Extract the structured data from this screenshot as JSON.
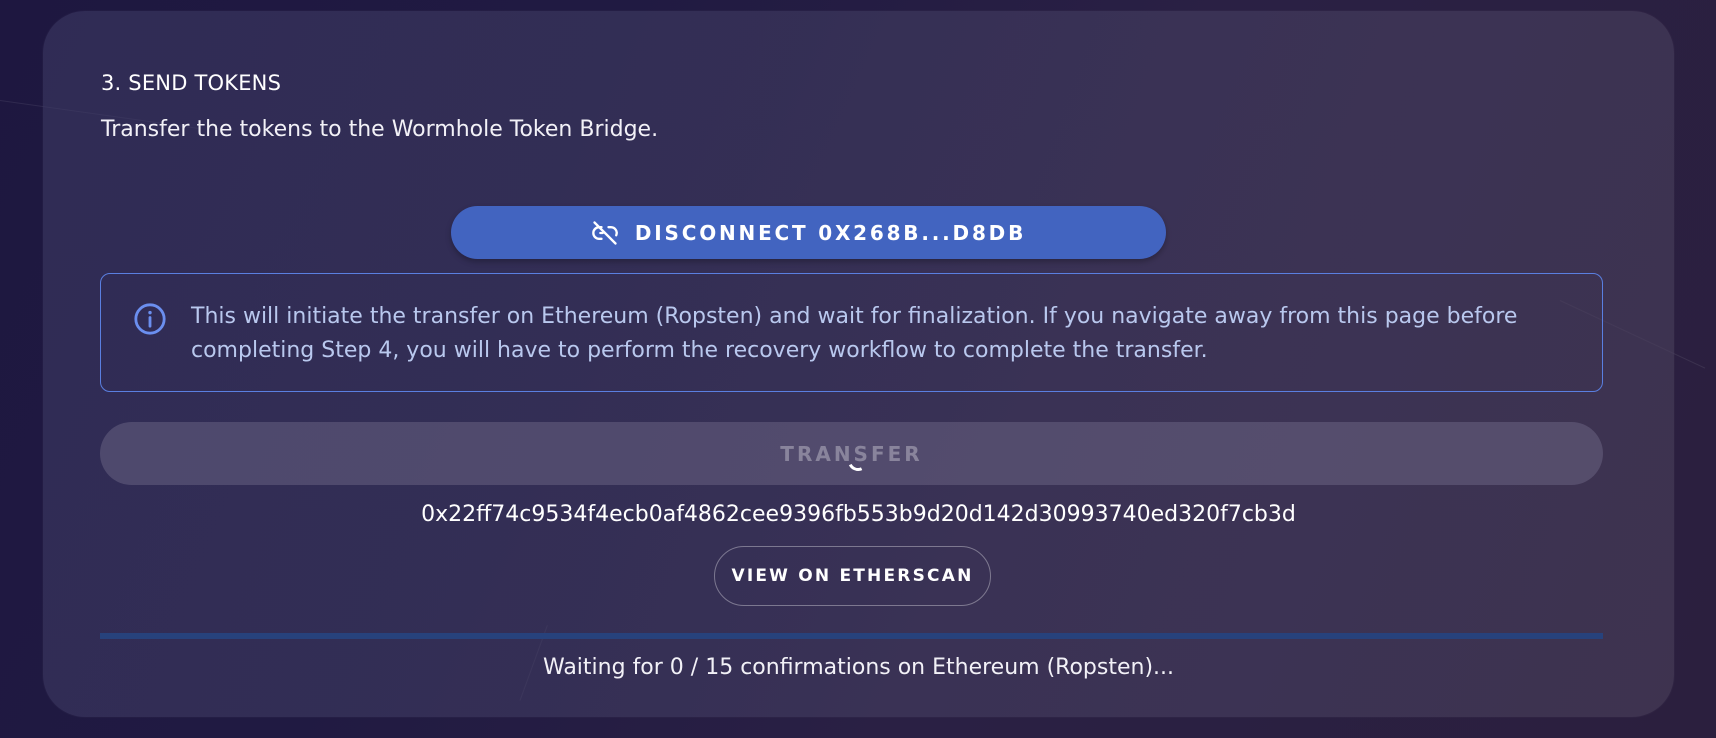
{
  "step": {
    "title": "3. SEND TOKENS",
    "description": "Transfer the tokens to the Wormhole Token Bridge."
  },
  "wallet": {
    "disconnect_label": "DISCONNECT 0X268B...D8DB",
    "icon": "link-off-icon"
  },
  "info": {
    "icon": "info-icon",
    "message": "This will initiate the transfer on Ethereum (Ropsten) and wait for finalization. If you navigate away from this page before completing Step 4, you will have to perform the recovery workflow to complete the transfer."
  },
  "transfer": {
    "label": "TRANSFER",
    "disabled": true,
    "loading": true
  },
  "transaction": {
    "hash": "0x22ff74c9534f4ecb0af4862cee9396fb553b9d20d142d30993740ed320f7cb3d",
    "explorer_label": "VIEW ON ETHERSCAN"
  },
  "confirmations": {
    "current": 0,
    "required": 15,
    "progress": 0,
    "status_text": "Waiting for 0 / 15 confirmations on Ethereum (Ropsten)..."
  },
  "colors": {
    "primary_button": "#4264c0",
    "info_border": "#5a7fe0",
    "progress_track": "#27427c"
  }
}
